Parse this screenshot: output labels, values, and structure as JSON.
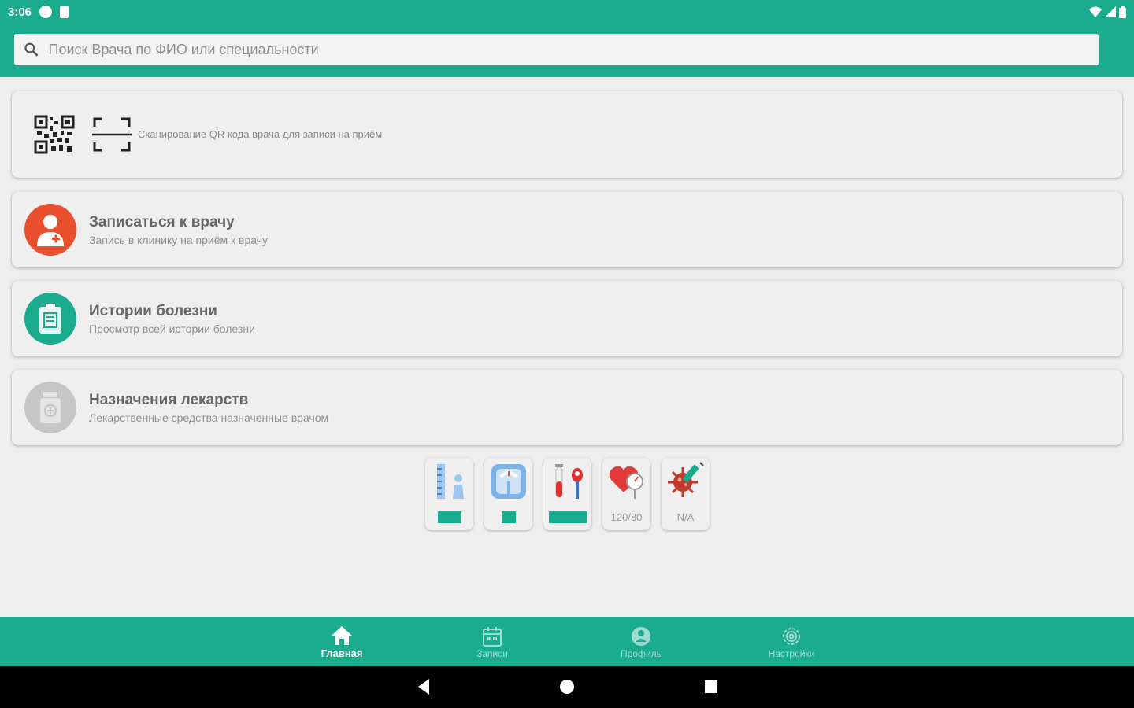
{
  "status_bar": {
    "time": "3:06"
  },
  "search": {
    "placeholder": "Поиск Врача по ФИО или специальности"
  },
  "qr_card": {
    "text": "Сканирование QR кода врача для записи на приём"
  },
  "menu": [
    {
      "title": "Записаться к врачу",
      "subtitle": "Запись в клинику на приём к врачу",
      "icon": "doctor-icon",
      "color": "#e8502e"
    },
    {
      "title": "Истории болезни",
      "subtitle": "Просмотр всей истории болезни",
      "icon": "clipboard-icon",
      "color": "#1aac8d"
    },
    {
      "title": "Назначения лекарств",
      "subtitle": "Лекарственные средства назначенные врачом",
      "icon": "medicine-bottle-icon",
      "color": "#c6c6c6"
    }
  ],
  "metrics": [
    {
      "icon": "height-icon",
      "value": ""
    },
    {
      "icon": "scale-icon",
      "value": ""
    },
    {
      "icon": "blood-test-icon",
      "value": ""
    },
    {
      "icon": "blood-pressure-icon",
      "value": "120/80"
    },
    {
      "icon": "virus-icon",
      "value": "N/A"
    }
  ],
  "bottom_nav": [
    {
      "label": "Главная",
      "icon": "home-icon",
      "active": true
    },
    {
      "label": "Записи",
      "icon": "calendar-icon",
      "active": false
    },
    {
      "label": "Профиль",
      "icon": "profile-icon",
      "active": false
    },
    {
      "label": "Настройки",
      "icon": "settings-icon",
      "active": false
    }
  ],
  "colors": {
    "accent": "#1aac8d",
    "background": "#eeeeee",
    "doctor": "#e8502e"
  }
}
